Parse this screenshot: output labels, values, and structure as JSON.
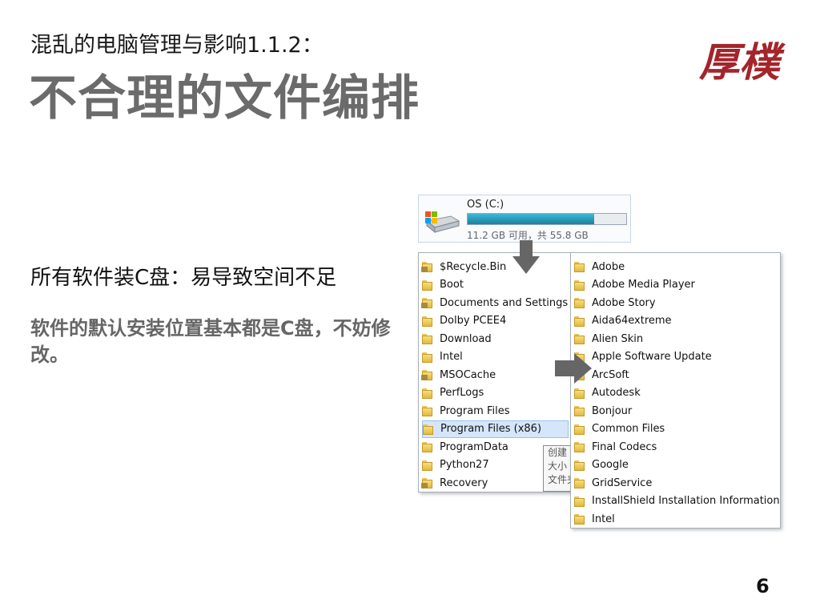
{
  "slide": {
    "subtitle": "混乱的电脑管理与影响1.1.2：",
    "title": "不合理的文件编排",
    "logo": "厚樸",
    "point": "所有软件装C盘：易导致空间不足",
    "note": "软件的默认安装位置基本都是C盘，不妨修改。",
    "page_number": "6"
  },
  "drive": {
    "label": "OS (C:)",
    "space_text": "11.2 GB 可用，共 55.8 GB",
    "used_fraction": 0.8
  },
  "left_folders": [
    {
      "name": "$Recycle.Bin",
      "locked": true
    },
    {
      "name": "Boot",
      "locked": false
    },
    {
      "name": "Documents and Settings",
      "locked": true
    },
    {
      "name": "Dolby PCEE4",
      "locked": false
    },
    {
      "name": "Download",
      "locked": false
    },
    {
      "name": "Intel",
      "locked": false
    },
    {
      "name": "MSOCache",
      "locked": true
    },
    {
      "name": "PerfLogs",
      "locked": false
    },
    {
      "name": "Program Files",
      "locked": false
    },
    {
      "name": "Program Files (x86)",
      "locked": false,
      "selected": true
    },
    {
      "name": "ProgramData",
      "locked": false
    },
    {
      "name": "Python27",
      "locked": false
    },
    {
      "name": "Recovery",
      "locked": true
    }
  ],
  "right_folders": [
    "Adobe",
    "Adobe Media Player",
    "Adobe Story",
    "Aida64extreme",
    "Alien Skin",
    "Apple Software Update",
    "ArcSoft",
    "Autodesk",
    "Bonjour",
    "Common Files",
    "Final Codecs",
    "Google",
    "GridService",
    "InstallShield Installation Information",
    "Intel"
  ],
  "tooltip_lines": [
    "创建",
    "大小",
    "文件夹"
  ],
  "colors": {
    "title_gray": "#6b6b6b",
    "logo_red": "#a3252b",
    "arrow_gray": "#666666",
    "selection_blue": "#d5e6fa"
  }
}
